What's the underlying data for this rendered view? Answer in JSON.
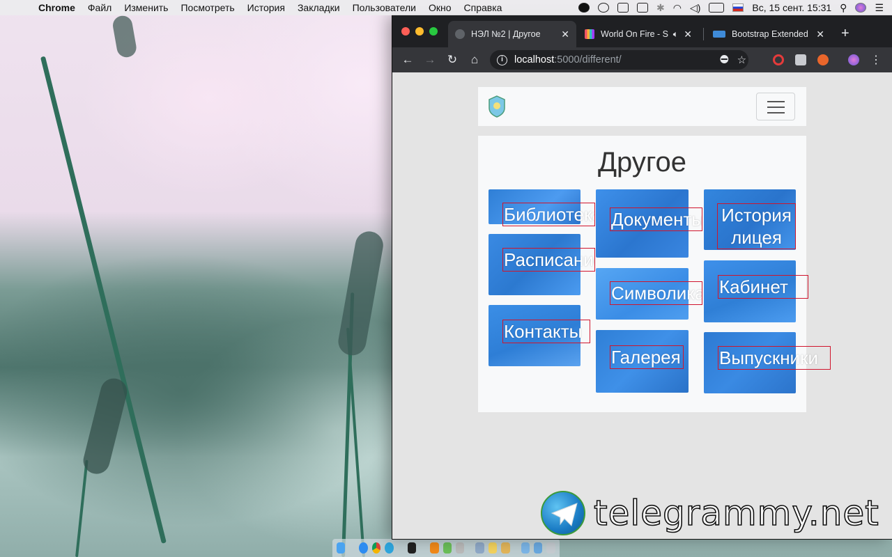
{
  "menubar": {
    "app_name": "Chrome",
    "menus": [
      "Файл",
      "Изменить",
      "Посмотреть",
      "История",
      "Закладки",
      "Пользователи",
      "Окно",
      "Справка"
    ],
    "clock": "Вс, 15 сент.  15:31"
  },
  "browser": {
    "tabs": [
      {
        "title": "НЭЛ №2 | Другое",
        "active": true
      },
      {
        "title": "World On Fire - S",
        "active": false
      },
      {
        "title": "Bootstrap Extended",
        "active": false
      }
    ],
    "url_host": "localhost",
    "url_path": ":5000/different/"
  },
  "page": {
    "title": "Другое",
    "tiles": [
      {
        "label": "Библиотека"
      },
      {
        "label": "Расписание"
      },
      {
        "label": "Контакты"
      },
      {
        "label": "Документы"
      },
      {
        "label": "Символика"
      },
      {
        "label": "Галерея"
      },
      {
        "label": "История лицея"
      },
      {
        "label": "Кабинет"
      },
      {
        "label": "Выпускники"
      }
    ]
  },
  "watermark": "telegrammy.net",
  "colors": {
    "tile_blue": "#3d8ee8",
    "caption_border": "#d0142c",
    "toolbar": "#35363a"
  }
}
